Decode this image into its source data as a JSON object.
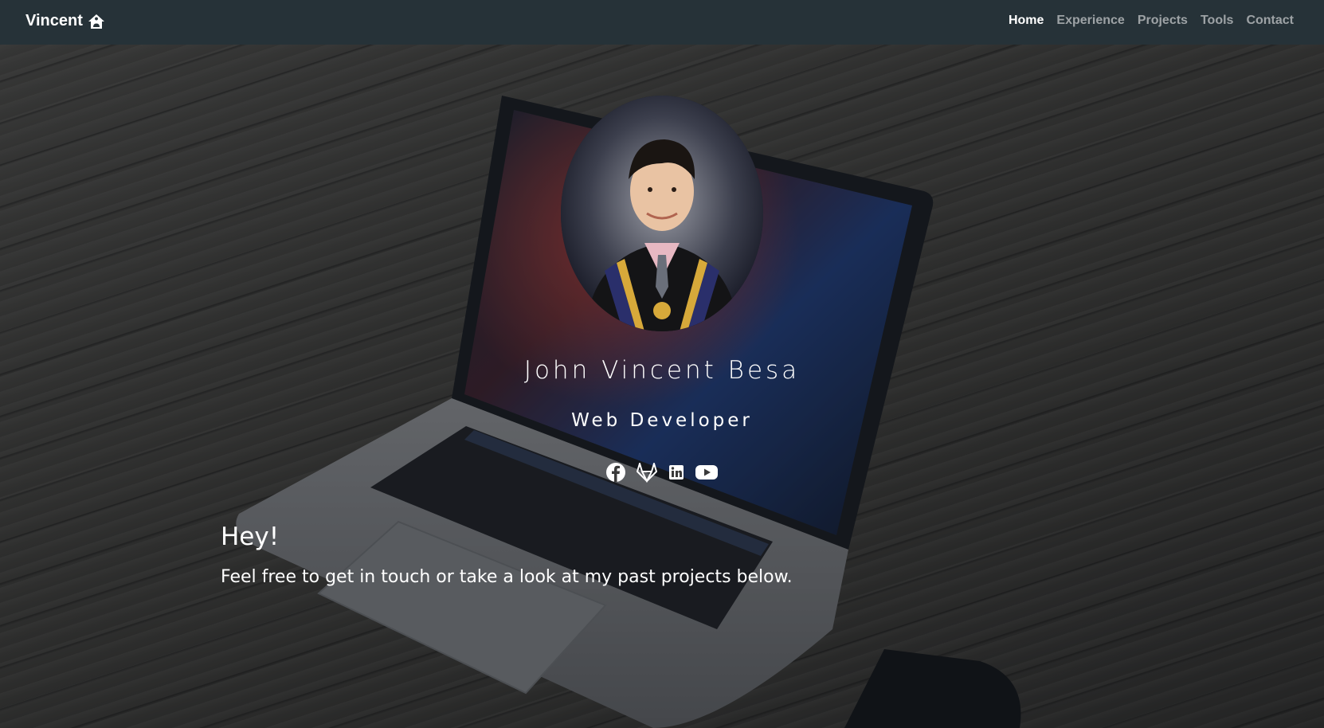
{
  "nav": {
    "brand": "Vincent",
    "brand_icon": "home-icon",
    "items": [
      {
        "label": "Home",
        "active": true
      },
      {
        "label": "Experience",
        "active": false
      },
      {
        "label": "Projects",
        "active": false
      },
      {
        "label": "Tools",
        "active": false
      },
      {
        "label": "Contact",
        "active": false
      }
    ]
  },
  "hero": {
    "name": "John Vincent Besa",
    "role": "Web Developer",
    "socials": [
      {
        "icon": "facebook-icon"
      },
      {
        "icon": "gitlab-icon"
      },
      {
        "icon": "linkedin-icon"
      },
      {
        "icon": "youtube-icon"
      }
    ],
    "greeting": "Hey!",
    "tagline": "Feel free to get in touch or take a look at my past projects below."
  },
  "colors": {
    "navbar": "#263238",
    "nav_inactive": "#9aa3a8",
    "text": "#ffffff"
  }
}
